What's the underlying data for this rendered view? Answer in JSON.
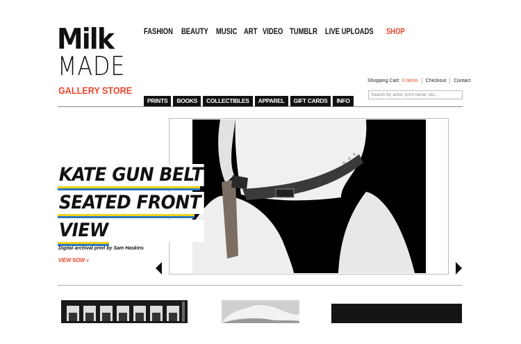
{
  "logo": {
    "line1": "Milk",
    "line2": "MADE",
    "line3": "GALLERY STORE"
  },
  "topnav": [
    "FASHION",
    "BEAUTY",
    "MUSIC",
    "ART",
    "VIDEO",
    "TUMBLR",
    "LIVE UPLOADS",
    "SHOP"
  ],
  "cart": {
    "label": "Shopping Cart:",
    "count": "0 Items",
    "checkout": "Checkout",
    "contact": "Contact"
  },
  "search": {
    "placeholder": "Search by artist, print name, etc..."
  },
  "categories": [
    "PRINTS",
    "BOOKS",
    "COLLECTIBLES",
    "APPAREL",
    "GIFT CARDS",
    "INFO"
  ],
  "hero": {
    "title_lines": [
      "KATE GUN BELT",
      "SEATED FRONT",
      "VIEW"
    ],
    "caption": "Digital archival print by Sam Haskins",
    "cta": "VIEW NOW »"
  },
  "colors": {
    "accent": "#e8452c",
    "stripe_yellow": "#f2d21b",
    "stripe_blue": "#2b78c4"
  }
}
